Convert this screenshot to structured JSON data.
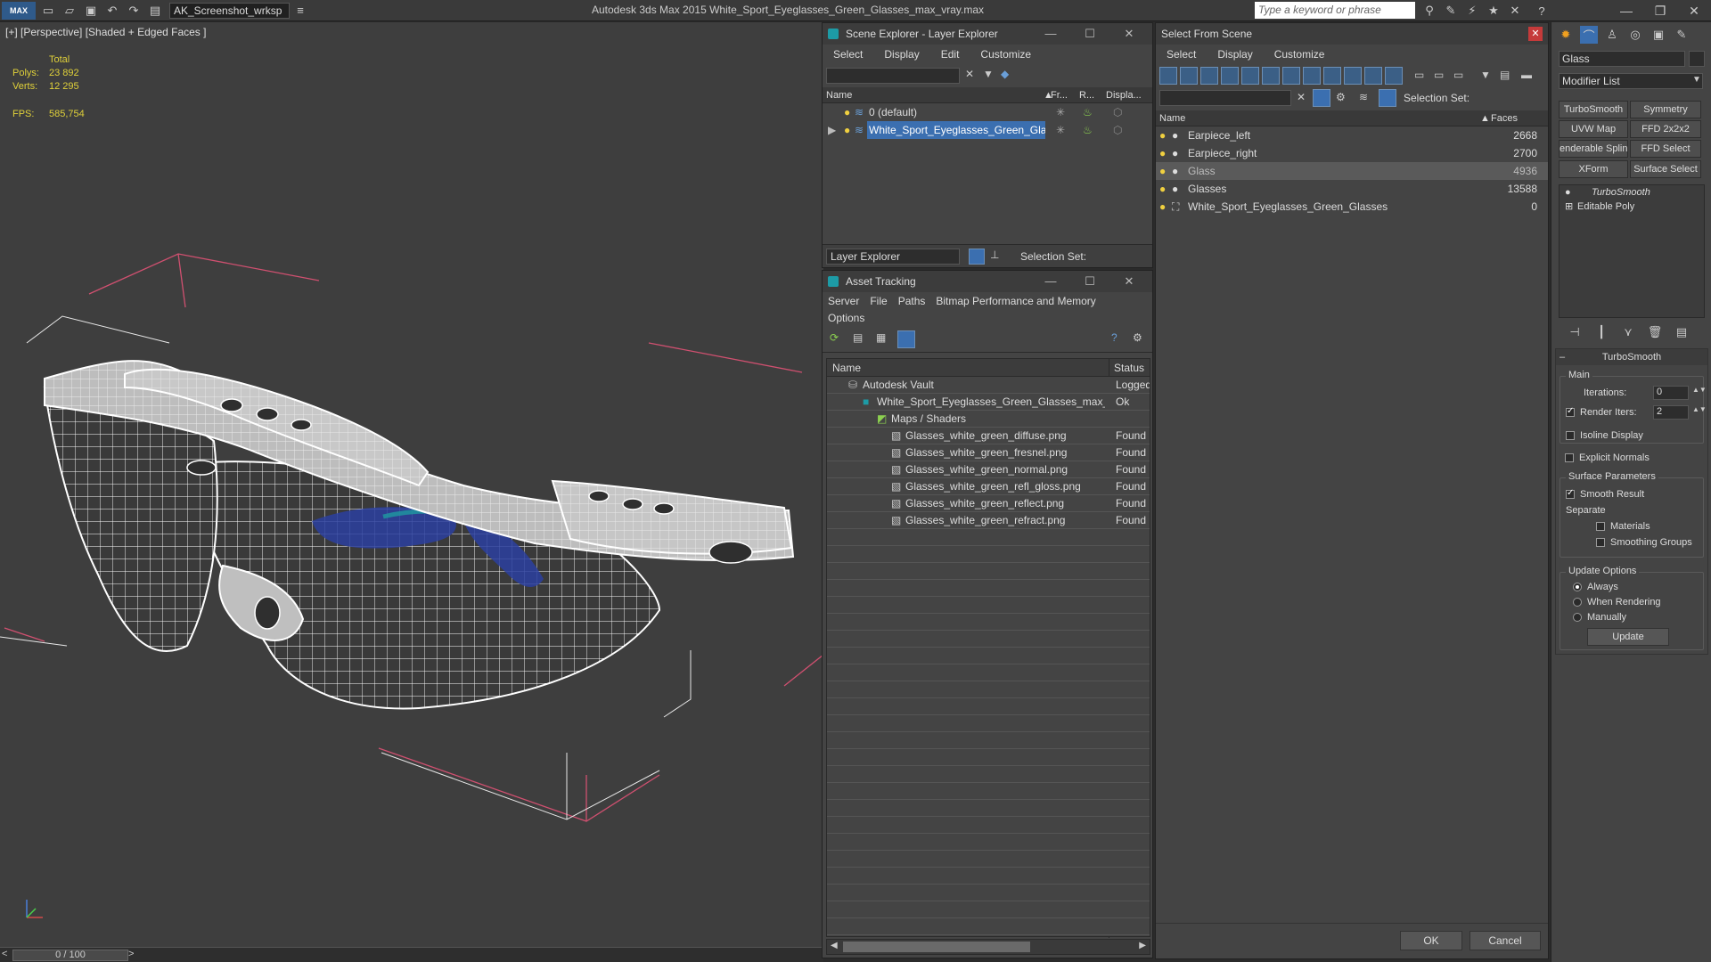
{
  "titlebar": {
    "app_logo": "MAX",
    "workspace": "AK_Screenshot_wrksp",
    "title": "Autodesk 3ds Max  2015    White_Sport_Eyeglasses_Green_Glasses_max_vray.max",
    "search_placeholder": "Type a keyword or phrase"
  },
  "viewport": {
    "label": "[+] [Perspective] [Shaded + Edged Faces ]",
    "stats": {
      "total_label": "Total",
      "polys_label": "Polys:",
      "polys_value": "23 892",
      "verts_label": "Verts:",
      "verts_value": "12 295",
      "fps_label": "FPS:",
      "fps_value": "585,754"
    },
    "timeline": "0 / 100",
    "timeline_prev": "<",
    "timeline_next": ">"
  },
  "scene_explorer": {
    "title": "Scene Explorer - Layer Explorer",
    "menu": [
      "Select",
      "Display",
      "Edit",
      "Customize"
    ],
    "columns": [
      "Name",
      "Fr...",
      "R...",
      "Displa..."
    ],
    "rows": [
      {
        "name": "0 (default)"
      },
      {
        "name": "White_Sport_Eyeglasses_Green_Glas..."
      }
    ],
    "layer_dropdown": "Layer Explorer",
    "selection_set_label": "Selection Set:"
  },
  "asset_tracking": {
    "title": "Asset Tracking",
    "menu": [
      "Server",
      "File",
      "Paths",
      "Bitmap Performance and Memory"
    ],
    "menu2": "Options",
    "columns": [
      "Name",
      "Status"
    ],
    "rows": [
      {
        "name": "Autodesk Vault",
        "status": "Logged"
      },
      {
        "name": "White_Sport_Eyeglasses_Green_Glasses_max_vr...",
        "status": "Ok"
      },
      {
        "name": "Maps / Shaders",
        "status": ""
      },
      {
        "name": "Glasses_white_green_diffuse.png",
        "status": "Found"
      },
      {
        "name": "Glasses_white_green_fresnel.png",
        "status": "Found"
      },
      {
        "name": "Glasses_white_green_normal.png",
        "status": "Found"
      },
      {
        "name": "Glasses_white_green_refl_gloss.png",
        "status": "Found"
      },
      {
        "name": "Glasses_white_green_reflect.png",
        "status": "Found"
      },
      {
        "name": "Glasses_white_green_refract.png",
        "status": "Found"
      }
    ]
  },
  "select_from_scene": {
    "title": "Select From Scene",
    "menu": [
      "Select",
      "Display",
      "Customize"
    ],
    "selection_set_label": "Selection Set:",
    "columns": [
      "Name",
      "Faces"
    ],
    "rows": [
      {
        "name": "Earpiece_left",
        "faces": "2668"
      },
      {
        "name": "Earpiece_right",
        "faces": "2700"
      },
      {
        "name": "Glass",
        "faces": "4936"
      },
      {
        "name": "Glasses",
        "faces": "13588"
      },
      {
        "name": "White_Sport_Eyeglasses_Green_Glasses",
        "faces": "0"
      }
    ],
    "ok": "OK",
    "cancel": "Cancel"
  },
  "command_panel": {
    "object_name": "Glass",
    "modifier_list": "Modifier List",
    "buttons": [
      "TurboSmooth",
      "Symmetry",
      "UVW Map",
      "FFD 2x2x2",
      "enderable Splin",
      "FFD Select",
      "XForm",
      "Surface Select"
    ],
    "stack": [
      "TurboSmooth",
      "Editable Poly"
    ],
    "rollout_title": "TurboSmooth",
    "main_label": "Main",
    "iterations_label": "Iterations:",
    "iterations_value": "0",
    "render_iters_label": "Render Iters:",
    "render_iters_value": "2",
    "isoline_label": "Isoline Display",
    "explicit_normals_label": "Explicit Normals",
    "surface_params_label": "Surface Parameters",
    "smooth_result_label": "Smooth Result",
    "separate_label": "Separate",
    "materials_label": "Materials",
    "smoothing_groups_label": "Smoothing Groups",
    "update_options_label": "Update Options",
    "always_label": "Always",
    "when_rendering_label": "When Rendering",
    "manually_label": "Manually",
    "update_button": "Update"
  },
  "colors": {
    "accent": "#3b6fb0",
    "stat_text": "#e0d13a",
    "selection": "#5a5a5a"
  }
}
